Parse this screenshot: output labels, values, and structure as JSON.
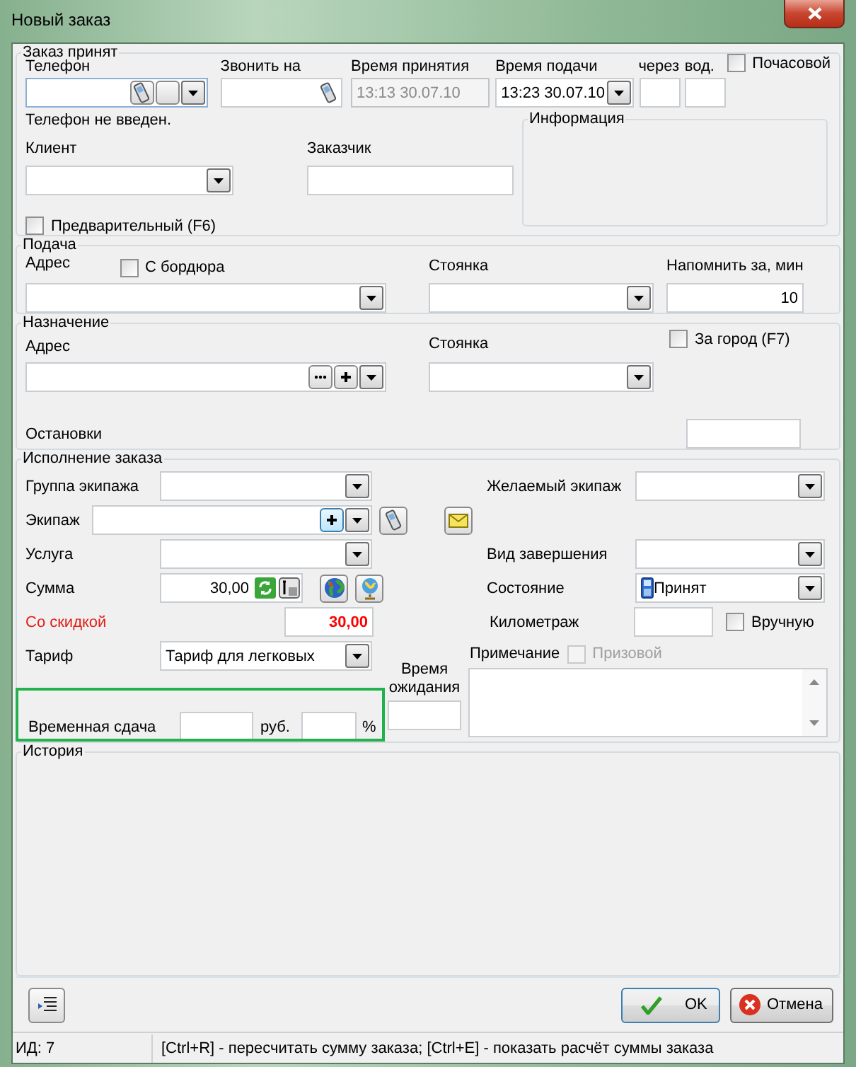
{
  "window": {
    "title": "Новый заказ"
  },
  "order_taken": {
    "legend": "Заказ принят",
    "phone": {
      "label": "Телефон"
    },
    "call_to": {
      "label": "Звонить на"
    },
    "time_taken": {
      "label": "Время принятия",
      "value": "13:13 30.07.10",
      "disabled": true
    },
    "time_pickup": {
      "label": "Время подачи",
      "value": "13:23 30.07.10"
    },
    "in": {
      "label": "через"
    },
    "driver": {
      "label": "вод."
    },
    "hourly": {
      "label": "Почасовой",
      "checked": false
    },
    "phone_status": "Телефон не введен.",
    "client": {
      "label": "Клиент"
    },
    "customer": {
      "label": "Заказчик"
    },
    "info": {
      "legend": "Информация"
    },
    "preliminary": {
      "label": "Предварительный (F6)",
      "checked": false
    }
  },
  "pickup": {
    "legend": "Подача",
    "address": {
      "label": "Адрес"
    },
    "curb": {
      "label": "С бордюра",
      "checked": false
    },
    "parking": {
      "label": "Стоянка"
    },
    "remind": {
      "label": "Напомнить за, мин",
      "value": "10"
    }
  },
  "destination": {
    "legend": "Назначение",
    "address": {
      "label": "Адрес"
    },
    "parking": {
      "label": "Стоянка"
    },
    "out_of_town": {
      "label": "За город (F7)",
      "checked": false
    },
    "stops": {
      "label": "Остановки"
    }
  },
  "execution": {
    "legend": "Исполнение заказа",
    "crew_group": {
      "label": "Группа экипажа"
    },
    "wanted_crew": {
      "label": "Желаемый экипаж"
    },
    "crew": {
      "label": "Экипаж"
    },
    "service": {
      "label": "Услуга"
    },
    "completion": {
      "label": "Вид завершения"
    },
    "sum": {
      "label": "Сумма",
      "value": "30,00"
    },
    "state": {
      "label": "Состояние",
      "value": "Принят"
    },
    "discounted": {
      "label": "Со скидкой",
      "value": "30,00"
    },
    "mileage": {
      "label": "Километраж"
    },
    "manual": {
      "label": "Вручную",
      "checked": false
    },
    "tariff": {
      "label": "Тариф",
      "value": "Тариф для легковых"
    },
    "note": {
      "label": "Примечание"
    },
    "prize": {
      "label": "Призовой",
      "checked": false,
      "disabled": true
    },
    "wait_time": {
      "label": "Время ожидания"
    },
    "temp_change": {
      "label": "Временная сдача",
      "unit": "руб.",
      "percent": "%"
    }
  },
  "history": {
    "legend": "История"
  },
  "buttons": {
    "ok": "OK",
    "cancel": "Отмена"
  },
  "status_bar": {
    "id": "ИД: 7",
    "hint": "[Ctrl+R] - пересчитать сумму заказа; [Ctrl+E] - показать расчёт суммы заказа"
  }
}
